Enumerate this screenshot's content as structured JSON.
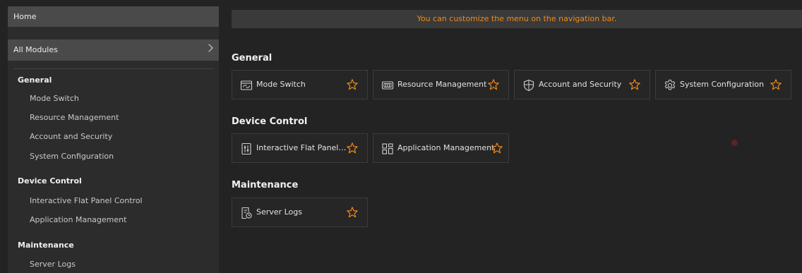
{
  "sidebar": {
    "home_label": "Home",
    "all_modules_label": "All Modules",
    "groups": [
      {
        "title": "General",
        "items": [
          "Mode Switch",
          "Resource Management",
          "Account and Security",
          "System Configuration"
        ]
      },
      {
        "title": "Device Control",
        "items": [
          "Interactive Flat Panel Control",
          "Application Management"
        ]
      },
      {
        "title": "Maintenance",
        "items": [
          "Server Logs"
        ]
      }
    ]
  },
  "banner": {
    "text": "You can customize the menu on the navigation bar."
  },
  "sections": [
    {
      "title": "General",
      "cards": [
        {
          "label": "Mode Switch",
          "icon": "mode-switch-icon"
        },
        {
          "label": "Resource Management",
          "icon": "resource-management-icon"
        },
        {
          "label": "Account and Security",
          "icon": "shield-icon"
        },
        {
          "label": "System Configuration",
          "icon": "gear-icon"
        }
      ]
    },
    {
      "title": "Device Control",
      "cards": [
        {
          "label": "Interactive Flat Panel C...",
          "icon": "panel-icon"
        },
        {
          "label": "Application Management",
          "icon": "apps-icon"
        }
      ]
    },
    {
      "title": "Maintenance",
      "cards": [
        {
          "label": "Server Logs",
          "icon": "log-icon"
        }
      ]
    }
  ],
  "colors": {
    "accent": "#f08a1a",
    "background": "#232323",
    "sidebar": "#2c2c2c",
    "highlight": "#4a4a4a"
  }
}
